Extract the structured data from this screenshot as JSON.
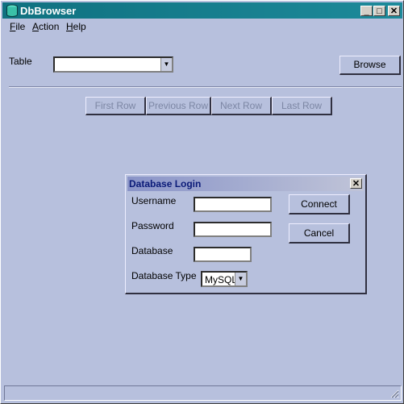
{
  "window": {
    "title": "DbBrowser",
    "controls": {
      "minimize": "_",
      "maximize": "□",
      "close": "✕"
    }
  },
  "menu": [
    {
      "label": "File",
      "mnemonic": "F"
    },
    {
      "label": "Action",
      "mnemonic": "A"
    },
    {
      "label": "Help",
      "mnemonic": "H"
    }
  ],
  "table_row": {
    "label": "Table",
    "selected": "",
    "browse_label": "Browse"
  },
  "navigation": {
    "first": "First Row",
    "previous": "Previous Row",
    "next": "Next Row",
    "last": "Last Row"
  },
  "login_dialog": {
    "title": "Database Login",
    "close": "✕",
    "username_label": "Username",
    "username_value": "",
    "password_label": "Password",
    "password_value": "",
    "database_label": "Database",
    "database_value": "",
    "type_label": "Database Type",
    "type_value": "MySQL",
    "connect_label": "Connect",
    "cancel_label": "Cancel"
  },
  "statusbar": {
    "text": ""
  }
}
